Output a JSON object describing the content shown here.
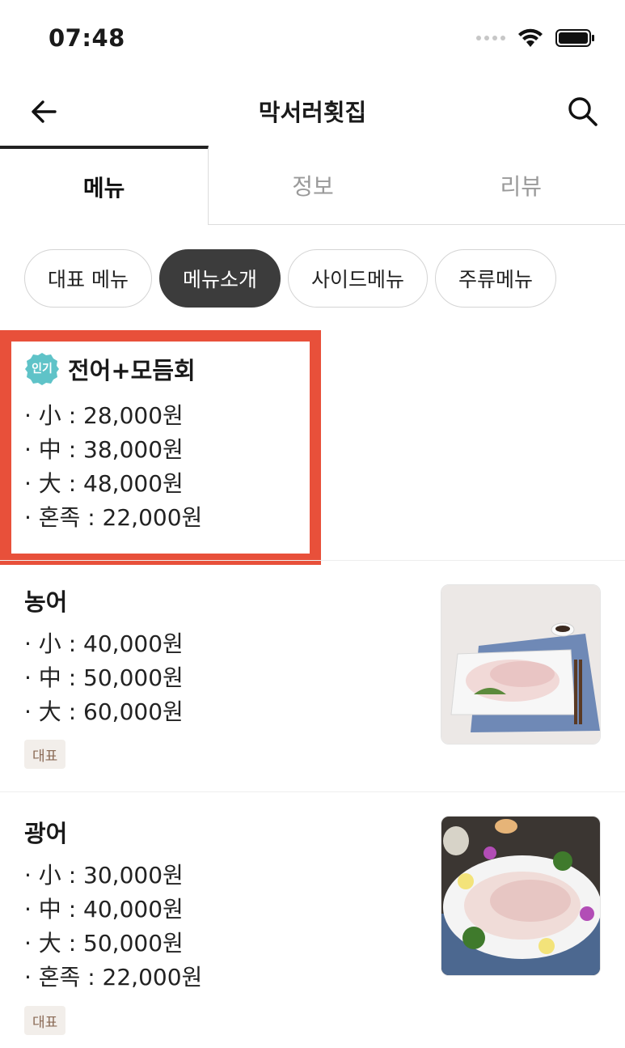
{
  "status_bar": {
    "time": "07:48"
  },
  "header": {
    "title": "막서러횟집"
  },
  "tabs": [
    {
      "label": "메뉴",
      "active": true
    },
    {
      "label": "정보",
      "active": false
    },
    {
      "label": "리뷰",
      "active": false
    }
  ],
  "chips": [
    {
      "label": "대표 메뉴",
      "active": false
    },
    {
      "label": "메뉴소개",
      "active": true
    },
    {
      "label": "사이드메뉴",
      "active": false
    },
    {
      "label": "주류메뉴",
      "active": false
    }
  ],
  "menu_items": [
    {
      "badge": "인기",
      "name": "전어+모듬회",
      "prices": [
        "· 小 : 28,000원",
        "· 中 : 38,000원",
        "· 大 : 48,000원",
        "· 혼족 : 22,000원"
      ],
      "highlighted": true
    },
    {
      "name": "농어",
      "prices": [
        "· 小 : 40,000원",
        "· 中 : 50,000원",
        "· 大 : 60,000원"
      ],
      "tag": "대표"
    },
    {
      "name": "광어",
      "prices": [
        "· 小 : 30,000원",
        "· 中 : 40,000원",
        "· 大 : 50,000원",
        "· 혼족 : 22,000원"
      ],
      "tag": "대표"
    }
  ],
  "colors": {
    "highlight": "#e8503a",
    "badge": "#5fc3c8",
    "active_chip": "#3c3c3c",
    "tag_bg": "#f2eeea"
  }
}
